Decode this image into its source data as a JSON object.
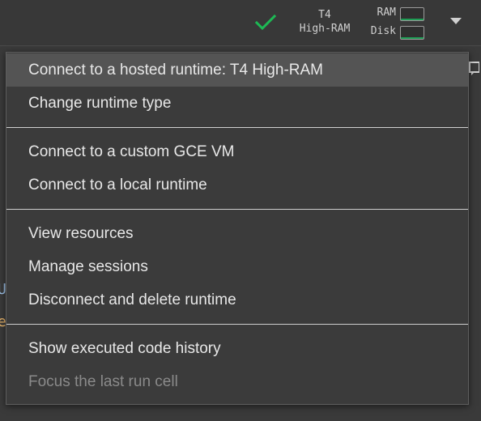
{
  "toolbar": {
    "status": "connected",
    "runtime_line1": "T4",
    "runtime_line2": "High-RAM",
    "ram_label": "RAM",
    "disk_label": "Disk",
    "ram_usage_fraction": 0.05,
    "disk_usage_fraction": 0.05,
    "status_color": "#1db954"
  },
  "menu": {
    "groups": [
      {
        "items": [
          {
            "label": "Connect to a hosted runtime: T4 High-RAM",
            "highlighted": true,
            "enabled": true
          },
          {
            "label": "Change runtime type",
            "enabled": true
          }
        ]
      },
      {
        "items": [
          {
            "label": "Connect to a custom GCE VM",
            "enabled": true
          },
          {
            "label": "Connect to a local runtime",
            "enabled": true
          }
        ]
      },
      {
        "items": [
          {
            "label": "View resources",
            "enabled": true
          },
          {
            "label": "Manage sessions",
            "enabled": true
          },
          {
            "label": "Disconnect and delete runtime",
            "enabled": true
          }
        ]
      },
      {
        "items": [
          {
            "label": "Show executed code history",
            "enabled": true
          },
          {
            "label": "Focus the last run cell",
            "enabled": false
          }
        ]
      }
    ]
  },
  "background": {
    "glyph_1": "U",
    "glyph_2": "e"
  },
  "colors": {
    "menu_background": "#3b3b3b",
    "highlight": "#545454",
    "text": "#e8e8e8",
    "disabled_text": "#8a8a8a",
    "meter_fill": "#1f9d55"
  }
}
